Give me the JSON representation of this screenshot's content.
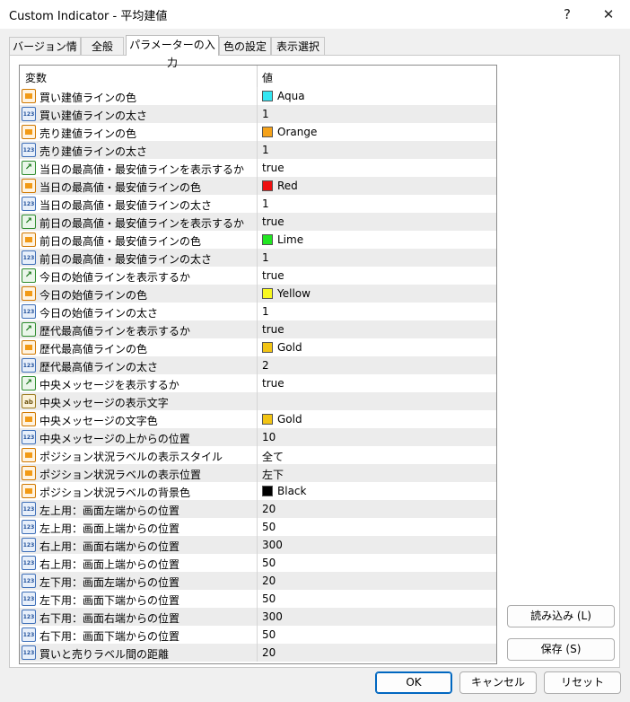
{
  "window": {
    "title": "Custom Indicator - 平均建値",
    "help_label": "?",
    "close_label": "✕"
  },
  "tabs": [
    {
      "label": "バージョン情報"
    },
    {
      "label": "全般"
    },
    {
      "label": "パラメーターの入力"
    },
    {
      "label": "色の設定"
    },
    {
      "label": "表示選択"
    }
  ],
  "grid": {
    "col_variable": "変数",
    "col_value": "値",
    "rows": [
      {
        "icon": "color",
        "label": "買い建値ラインの色",
        "value": "Aqua",
        "swatch": "#33e6f2"
      },
      {
        "icon": "num",
        "label": "買い建値ラインの太さ",
        "value": "1"
      },
      {
        "icon": "color",
        "label": "売り建値ラインの色",
        "value": "Orange",
        "swatch": "#f5a21a"
      },
      {
        "icon": "num",
        "label": "売り建値ラインの太さ",
        "value": "1"
      },
      {
        "icon": "bool",
        "label": "当日の最高値・最安値ラインを表示するか",
        "value": "true"
      },
      {
        "icon": "color",
        "label": "当日の最高値・最安値ラインの色",
        "value": "Red",
        "swatch": "#ee1111"
      },
      {
        "icon": "num",
        "label": "当日の最高値・最安値ラインの太さ",
        "value": "1"
      },
      {
        "icon": "bool",
        "label": "前日の最高値・最安値ラインを表示するか",
        "value": "true"
      },
      {
        "icon": "color",
        "label": "前日の最高値・最安値ラインの色",
        "value": "Lime",
        "swatch": "#22e622"
      },
      {
        "icon": "num",
        "label": "前日の最高値・最安値ラインの太さ",
        "value": "1"
      },
      {
        "icon": "bool",
        "label": "今日の始値ラインを表示するか",
        "value": "true"
      },
      {
        "icon": "color",
        "label": "今日の始値ラインの色",
        "value": "Yellow",
        "swatch": "#f7f71e"
      },
      {
        "icon": "num",
        "label": "今日の始値ラインの太さ",
        "value": "1"
      },
      {
        "icon": "bool",
        "label": "歴代最高値ラインを表示するか",
        "value": "true"
      },
      {
        "icon": "color",
        "label": "歴代最高値ラインの色",
        "value": "Gold",
        "swatch": "#f2c414"
      },
      {
        "icon": "num",
        "label": "歴代最高値ラインの太さ",
        "value": "2"
      },
      {
        "icon": "bool",
        "label": "中央メッセージを表示するか",
        "value": "true"
      },
      {
        "icon": "str",
        "label": "中央メッセージの表示文字",
        "value": ""
      },
      {
        "icon": "color",
        "label": "中央メッセージの文字色",
        "value": "Gold",
        "swatch": "#f2c414"
      },
      {
        "icon": "num",
        "label": "中央メッセージの上からの位置",
        "value": "10"
      },
      {
        "icon": "color",
        "label": "ポジション状況ラベルの表示スタイル",
        "value": "全て"
      },
      {
        "icon": "color",
        "label": "ポジション状況ラベルの表示位置",
        "value": "左下"
      },
      {
        "icon": "color",
        "label": "ポジション状況ラベルの背景色",
        "value": "Black",
        "swatch": "#000000"
      },
      {
        "icon": "num",
        "label": "左上用：画面左端からの位置",
        "value": "20"
      },
      {
        "icon": "num",
        "label": "左上用：画面上端からの位置",
        "value": "50"
      },
      {
        "icon": "num",
        "label": "右上用：画面右端からの位置",
        "value": "300"
      },
      {
        "icon": "num",
        "label": "右上用：画面上端からの位置",
        "value": "50"
      },
      {
        "icon": "num",
        "label": "左下用：画面左端からの位置",
        "value": "20"
      },
      {
        "icon": "num",
        "label": "左下用：画面下端からの位置",
        "value": "50"
      },
      {
        "icon": "num",
        "label": "右下用：画面右端からの位置",
        "value": "300"
      },
      {
        "icon": "num",
        "label": "右下用：画面下端からの位置",
        "value": "50"
      },
      {
        "icon": "num",
        "label": "買いと売りラベル間の距離",
        "value": "20"
      }
    ]
  },
  "icon_text": {
    "num": "123",
    "bool": "↗",
    "str": "ab",
    "color": ""
  },
  "side_buttons": {
    "load": "読み込み (L)",
    "save": "保存 (S)"
  },
  "footer": {
    "ok": "OK",
    "cancel": "キャンセル",
    "reset": "リセット"
  }
}
